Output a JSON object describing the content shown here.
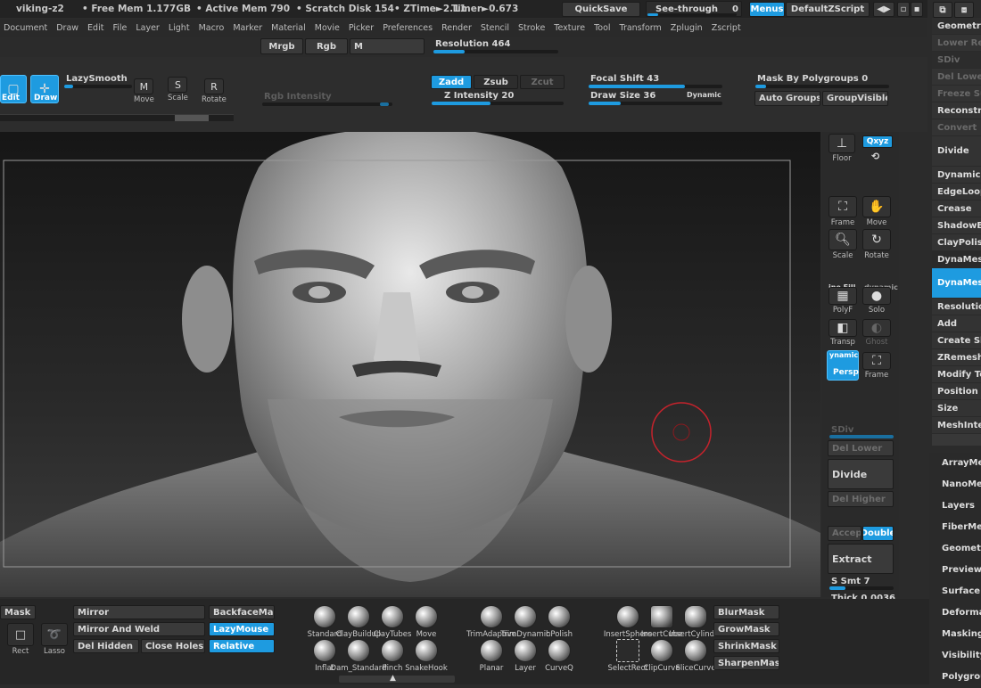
{
  "titlebar": {
    "app_name": "viking-z2",
    "free_mem": "• Free Mem 1.177GB",
    "active_mem": "• Active Mem 790",
    "scratch": "• Scratch Disk 154",
    "ztime": "• ZTime►2.11",
    "timer": "Timer►0.673",
    "quicksave": "QuickSave",
    "see_through": "See-through",
    "see_through_value": "0",
    "menus": "Menus",
    "default_script": "DefaultZScript"
  },
  "menubar": [
    "Document",
    "Draw",
    "Edit",
    "File",
    "Layer",
    "Light",
    "Macro",
    "Marker",
    "Material",
    "Movie",
    "Picker",
    "Preferences",
    "Render",
    "Stencil",
    "Stroke",
    "Texture",
    "Tool",
    "Transform",
    "Zplugin",
    "Zscript"
  ],
  "topstrip": {
    "mrgb": "Mrgb",
    "rgb": "Rgb",
    "m": "M",
    "resolution": "Resolution 464",
    "resolution_fraction": 0.25
  },
  "toolbar": {
    "edit": "Edit",
    "draw": "Draw",
    "lazysmooth": "LazySmooth",
    "move": "Move",
    "scale": "Scale",
    "rotate": "Rotate",
    "rgb_intensity": "Rgb Intensity",
    "zadd": "Zadd",
    "zsub": "Zsub",
    "zcut": "Zcut",
    "z_intensity": "Z Intensity 20",
    "z_intensity_fraction": 0.2,
    "focal_shift": "Focal Shift 43",
    "draw_size": "Draw Size 36",
    "draw_size_fraction": 0.12,
    "dynamic": "Dynamic",
    "mask_by_polygroups": "Mask By Polygroups 0",
    "auto_groups": "Auto Groups",
    "group_visible": "GroupVisible"
  },
  "shelf": {
    "floor": "Floor",
    "xyz": "Qxyz",
    "frame": "Frame",
    "move": "Move",
    "scale": "Scale",
    "rotate": "Rotate",
    "polyf": "PolyF",
    "line_fill": "ine Fill",
    "solo": "Solo",
    "solo_badge": "dynamic",
    "transp": "Transp",
    "ghost": "Ghost",
    "persp": "Persp",
    "persp_badge": "ynamic",
    "frame2": "Frame",
    "sdiv": "SDiv",
    "del_lower": "Del Lower",
    "divide": "Divide",
    "del_higher": "Del Higher",
    "accept": "Accept",
    "double": "Double",
    "extract": "Extract",
    "s_smt": "S Smt 7",
    "thick": "Thick 0.0036"
  },
  "right_panel": {
    "header": "Geometry",
    "items": [
      "Lower Res",
      "SDiv",
      "Del Lower",
      "Freeze SubD",
      "Reconstruct",
      "Convert",
      "Divide",
      "DynamicSubdiv",
      "EdgeLoop",
      "Crease",
      "ShadowBox",
      "ClayPolish",
      "DynaMesh",
      "DynaMesh",
      "Resolution",
      "Add",
      "Create Shell",
      "ZRemesher",
      "Modify Topology",
      "Position",
      "Size",
      "MeshIntegrity"
    ]
  },
  "right_list": [
    "ArrayMesh",
    "NanoMesh",
    "Layers",
    "FiberMesh",
    "Geometry HD",
    "Preview",
    "Surface",
    "Deformation",
    "Masking",
    "Visibility",
    "Polygroups"
  ],
  "bottom": {
    "mask": "Mask",
    "rect": "Rect",
    "lasso": "Lasso",
    "mirror": "Mirror",
    "mirror_and_weld": "Mirror And Weld",
    "del_hidden": "Del Hidden",
    "close_holes": "Close Holes",
    "backface_mask": "BackfaceMask",
    "lazymouse": "LazyMouse",
    "relative": "Relative",
    "brushes_row1": [
      "Standard",
      "ClayBuildup",
      "ClayTubes",
      "Move"
    ],
    "brushes_row2": [
      "Inflat",
      "Dam_Standard",
      "Pinch",
      "SnakeHook"
    ],
    "brushes_row3": [
      "TrimAdaptive",
      "TrimDynamic",
      "hPolish"
    ],
    "brushes_row4": [
      "Planar",
      "Layer",
      "CurveQ"
    ],
    "insert_row1": [
      "InsertSphere",
      "InsertCube",
      "InsertCylinder"
    ],
    "insert_row2": [
      "SelectRect",
      "ClipCurve",
      "SliceCurve"
    ],
    "masks": [
      "BlurMask",
      "GrowMask",
      "ShrinkMask",
      "SharpenMask"
    ]
  }
}
